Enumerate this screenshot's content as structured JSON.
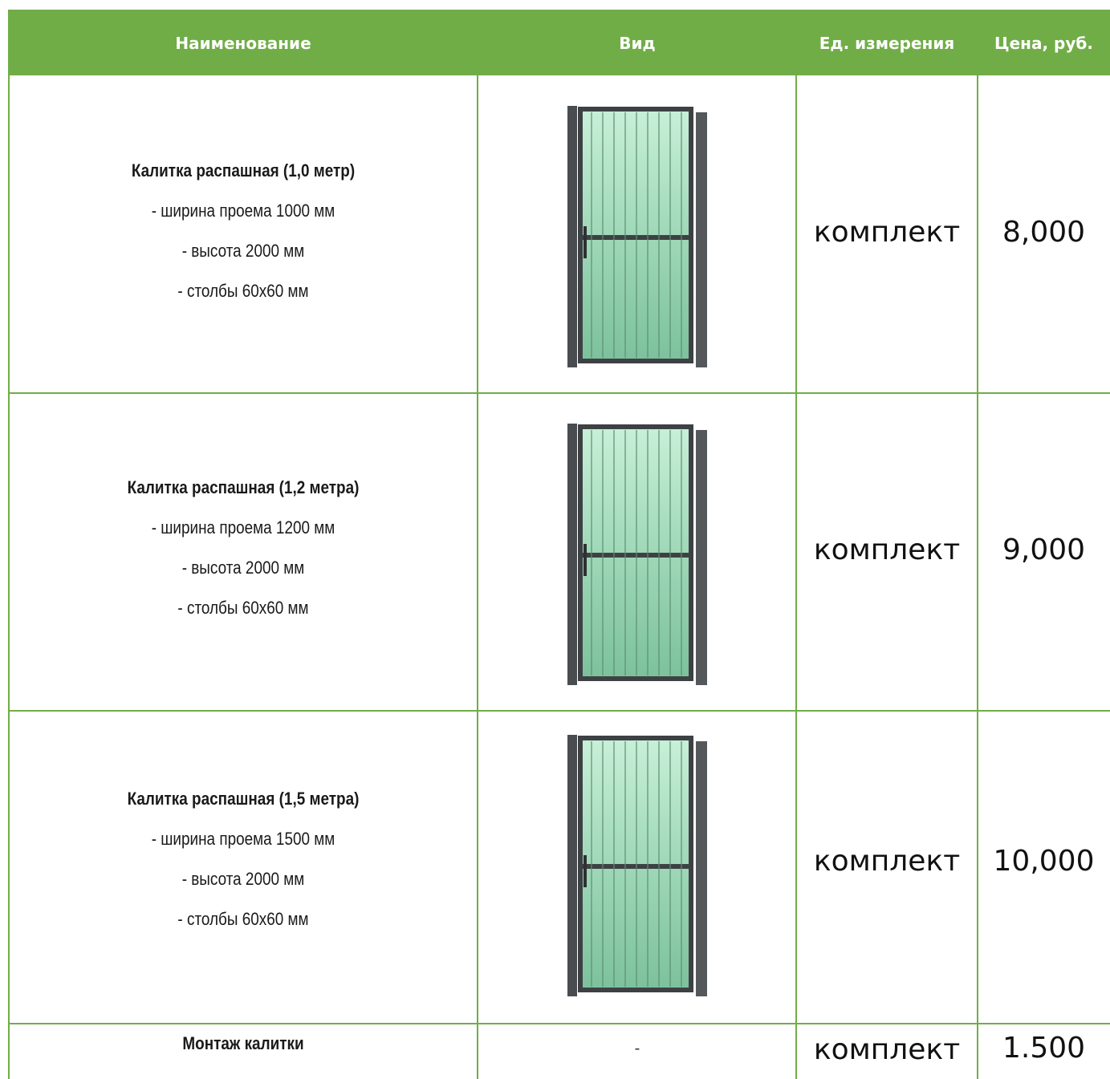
{
  "header": {
    "name": "Наименование",
    "view": "Вид",
    "unit": "Ед. измерения",
    "price": "Цена, руб."
  },
  "rows": [
    {
      "title": "Калитка распашная (1,0 метр)",
      "width": "- ширина проема 1000 мм",
      "height": "- высота 2000 мм",
      "posts": "- столбы 60х60 мм",
      "unit": "комплект",
      "price": "8,000",
      "image": "gate-image"
    },
    {
      "title": "Калитка распашная (1,2 метра)",
      "width": "- ширина проема 1200 мм",
      "height": "- высота 2000 мм",
      "posts": "- столбы 60х60 мм",
      "unit": "комплект",
      "price": "9,000",
      "image": "gate-image"
    },
    {
      "title": "Калитка распашная (1,5 метра)",
      "width": "- ширина проема 1500 мм",
      "height": "- высота 2000 мм",
      "posts": "- столбы 60х60 мм",
      "unit": "комплект",
      "price": "10,000",
      "image": "gate-image"
    },
    {
      "title": "Монтаж калитки",
      "view": "-",
      "unit": "комплект",
      "price": "1.500"
    }
  ],
  "colors": {
    "header_bg": "#70ad47",
    "border": "#70ad47",
    "gate_frame": "#4a4d50",
    "gate_panel": "#9fd8b8"
  }
}
